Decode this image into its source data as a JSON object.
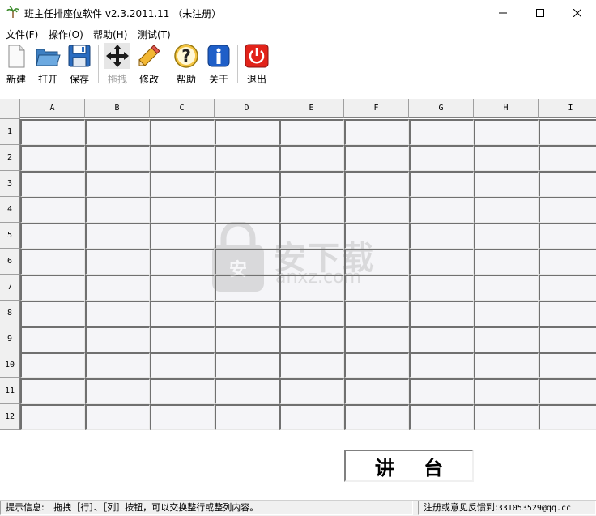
{
  "window": {
    "title": "班主任排座位软件 v2.3.2011.11 （未注册）",
    "app_icon": "palm-tree-icon",
    "controls": [
      "minimize-icon",
      "maximize-icon",
      "close-icon"
    ]
  },
  "menu": {
    "items": [
      "文件(F)",
      "操作(O)",
      "帮助(H)",
      "测试(T)"
    ]
  },
  "toolbar": {
    "buttons": [
      {
        "label": "新建",
        "icon": "new-document-icon",
        "enabled": true
      },
      {
        "label": "打开",
        "icon": "open-folder-icon",
        "enabled": true
      },
      {
        "label": "保存",
        "icon": "save-disk-icon",
        "enabled": true
      },
      {
        "label": "拖拽",
        "icon": "move-arrows-icon",
        "enabled": false
      },
      {
        "label": "修改",
        "icon": "pencil-edit-icon",
        "enabled": true
      },
      {
        "label": "帮助",
        "icon": "help-question-icon",
        "enabled": true
      },
      {
        "label": "关于",
        "icon": "info-icon",
        "enabled": true
      },
      {
        "label": "退出",
        "icon": "power-exit-icon",
        "enabled": true
      }
    ]
  },
  "grid": {
    "columns": [
      "A",
      "B",
      "C",
      "D",
      "E",
      "F",
      "G",
      "H",
      "I"
    ],
    "rows": [
      "1",
      "2",
      "3",
      "4",
      "5",
      "6",
      "7",
      "8",
      "9",
      "10",
      "11",
      "12"
    ]
  },
  "podium": {
    "label": "讲 台"
  },
  "watermark": {
    "title": "安下载",
    "subtitle": "anxz.com"
  },
  "statusbar": {
    "hint_label": "提示信息:",
    "hint_text": "拖拽［行］、［列］按钮，可以交换整行或整列内容。",
    "feedback_label": "注册或意见反馈到:",
    "feedback_email": "331053529@qq.cc"
  }
}
